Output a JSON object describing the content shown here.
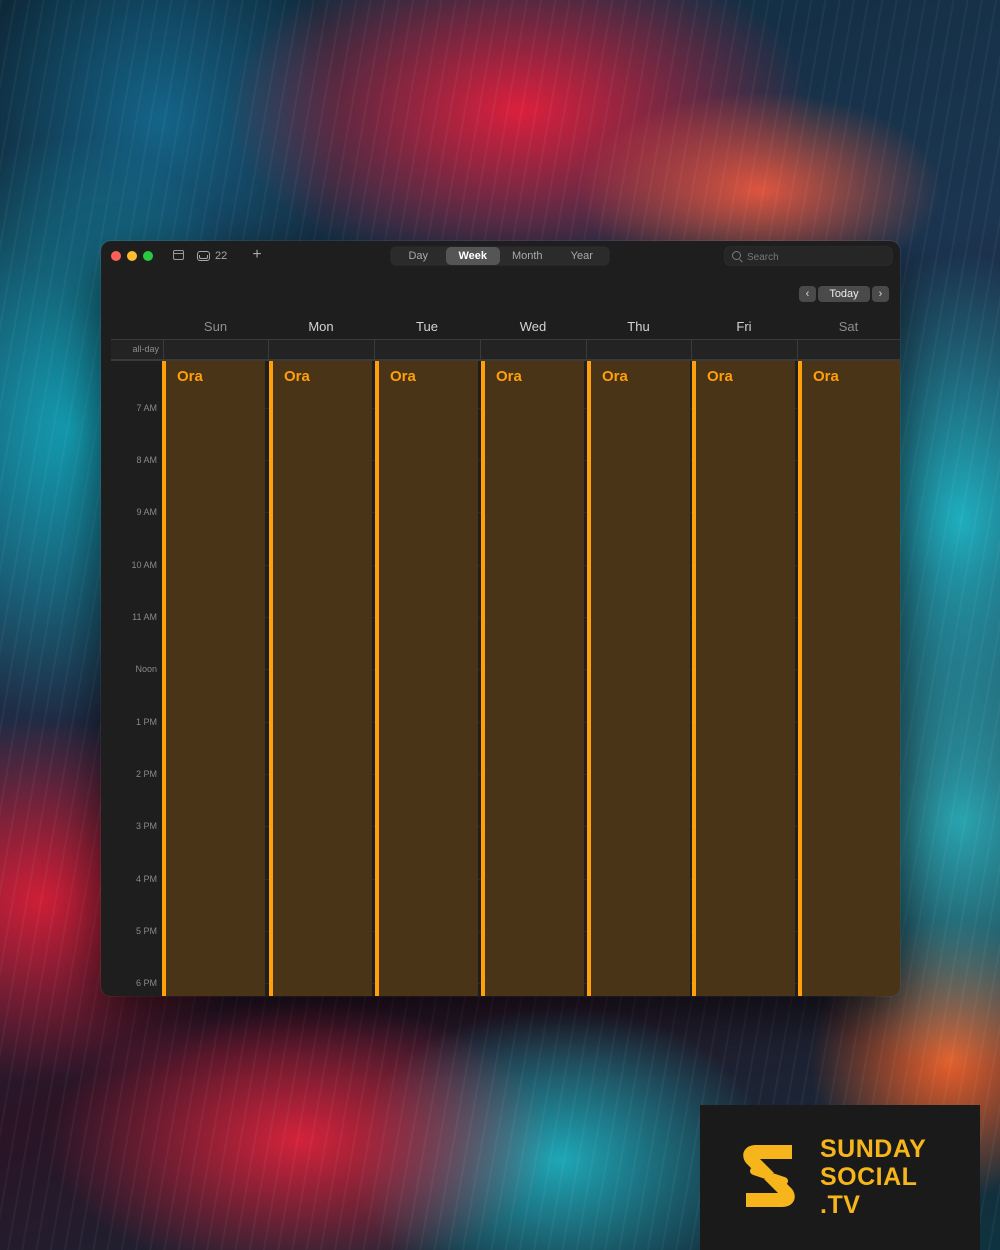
{
  "colors": {
    "accent": "#ff9f0a",
    "event_fill": "#4a3418",
    "window_bg": "#1e1e1e",
    "brand_yellow": "#f5b51b"
  },
  "toolbar": {
    "inbox_count": "22",
    "add_label": "+",
    "views": [
      "Day",
      "Week",
      "Month",
      "Year"
    ],
    "active_view": "Week",
    "search_placeholder": "Search"
  },
  "navigation": {
    "prev_label": "‹",
    "today_label": "Today",
    "next_label": "›"
  },
  "week": {
    "days": [
      "Sun",
      "Mon",
      "Tue",
      "Wed",
      "Thu",
      "Fri",
      "Sat"
    ],
    "allday_label": "all-day",
    "hours": [
      "7 AM",
      "8 AM",
      "9 AM",
      "10 AM",
      "11 AM",
      "Noon",
      "1 PM",
      "2 PM",
      "3 PM",
      "4 PM",
      "5 PM",
      "6 PM"
    ]
  },
  "events": [
    {
      "day": "Sun",
      "title": "Ora"
    },
    {
      "day": "Mon",
      "title": "Ora"
    },
    {
      "day": "Tue",
      "title": "Ora"
    },
    {
      "day": "Wed",
      "title": "Ora"
    },
    {
      "day": "Thu",
      "title": "Ora"
    },
    {
      "day": "Fri",
      "title": "Ora"
    },
    {
      "day": "Sat",
      "title": "Ora"
    }
  ],
  "brand": {
    "lines": [
      "SUNDAY",
      "SOCIAL",
      ".TV"
    ]
  },
  "icons": {
    "window": [
      "close-icon",
      "minimize-icon",
      "maximize-icon"
    ],
    "toolbar": [
      "calendar-list-icon",
      "inbox-icon",
      "search-icon"
    ],
    "brand": "sunday-social-logo-icon"
  }
}
